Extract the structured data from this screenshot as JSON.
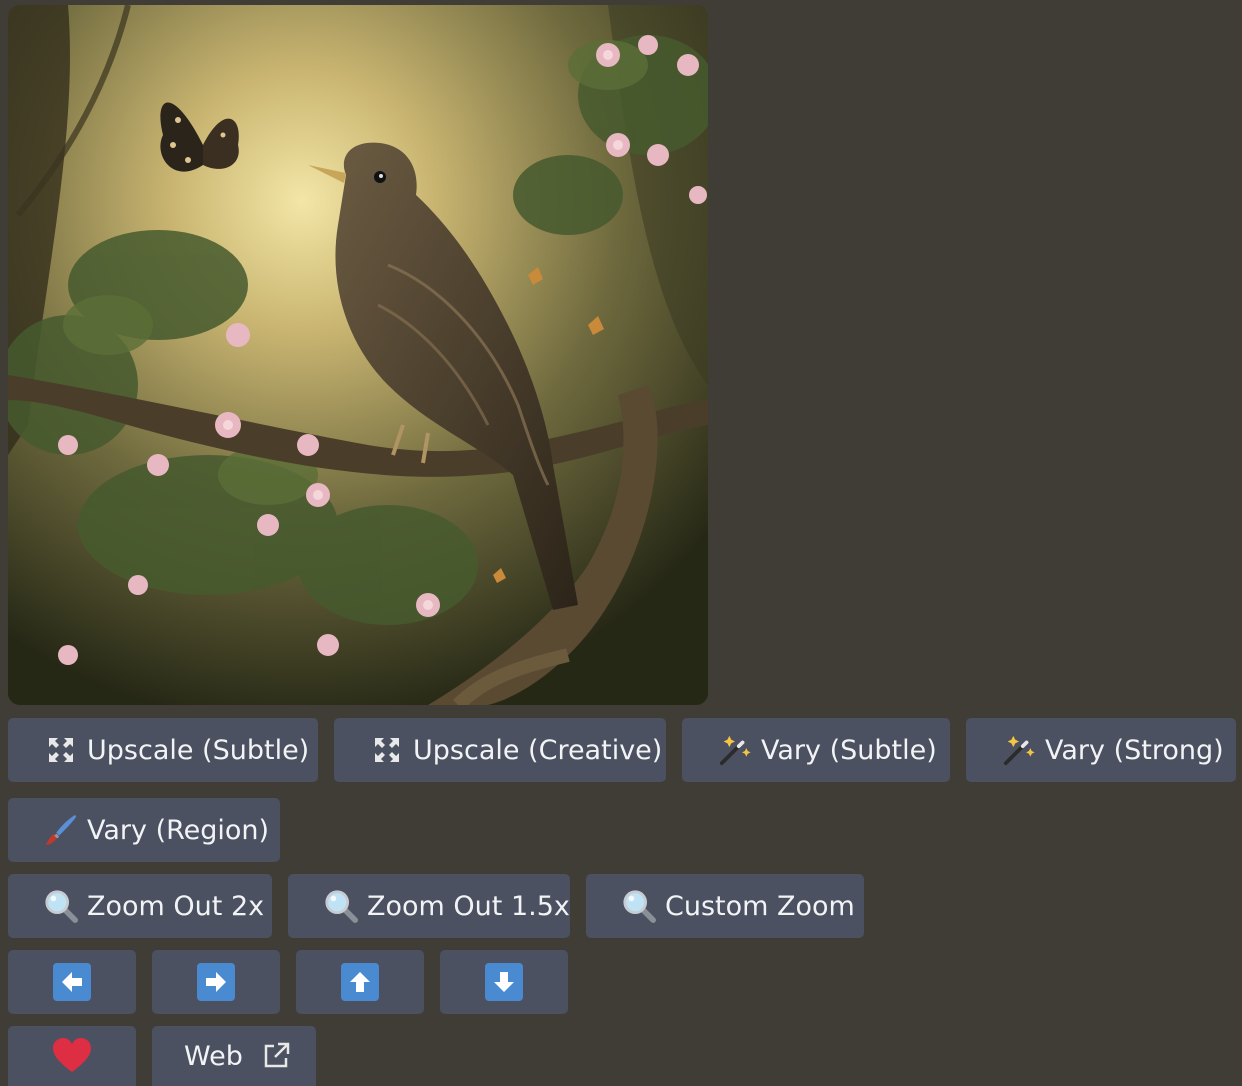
{
  "image": {
    "alt_icon": "bird-on-branch-artwork"
  },
  "rows": {
    "row1": {
      "upscale_subtle": "Upscale (Subtle)",
      "upscale_creative": "Upscale (Creative)",
      "vary_subtle": "Vary (Subtle)",
      "vary_strong": "Vary (Strong)"
    },
    "row2": {
      "vary_region": "Vary (Region)"
    },
    "row3": {
      "zoom_out_2x": "Zoom Out 2x",
      "zoom_out_1_5x": "Zoom Out 1.5x",
      "custom_zoom": "Custom Zoom"
    },
    "row4": {
      "pan_left_icon": "arrow-left-icon",
      "pan_right_icon": "arrow-right-icon",
      "pan_up_icon": "arrow-up-icon",
      "pan_down_icon": "arrow-down-icon"
    },
    "row5": {
      "favorite_icon": "heart-icon",
      "web": "Web"
    }
  },
  "colors": {
    "background": "#403d37",
    "button": "#4b5161",
    "arrow_blue": "#4a8ad1",
    "heart_red": "#dd2e44"
  }
}
